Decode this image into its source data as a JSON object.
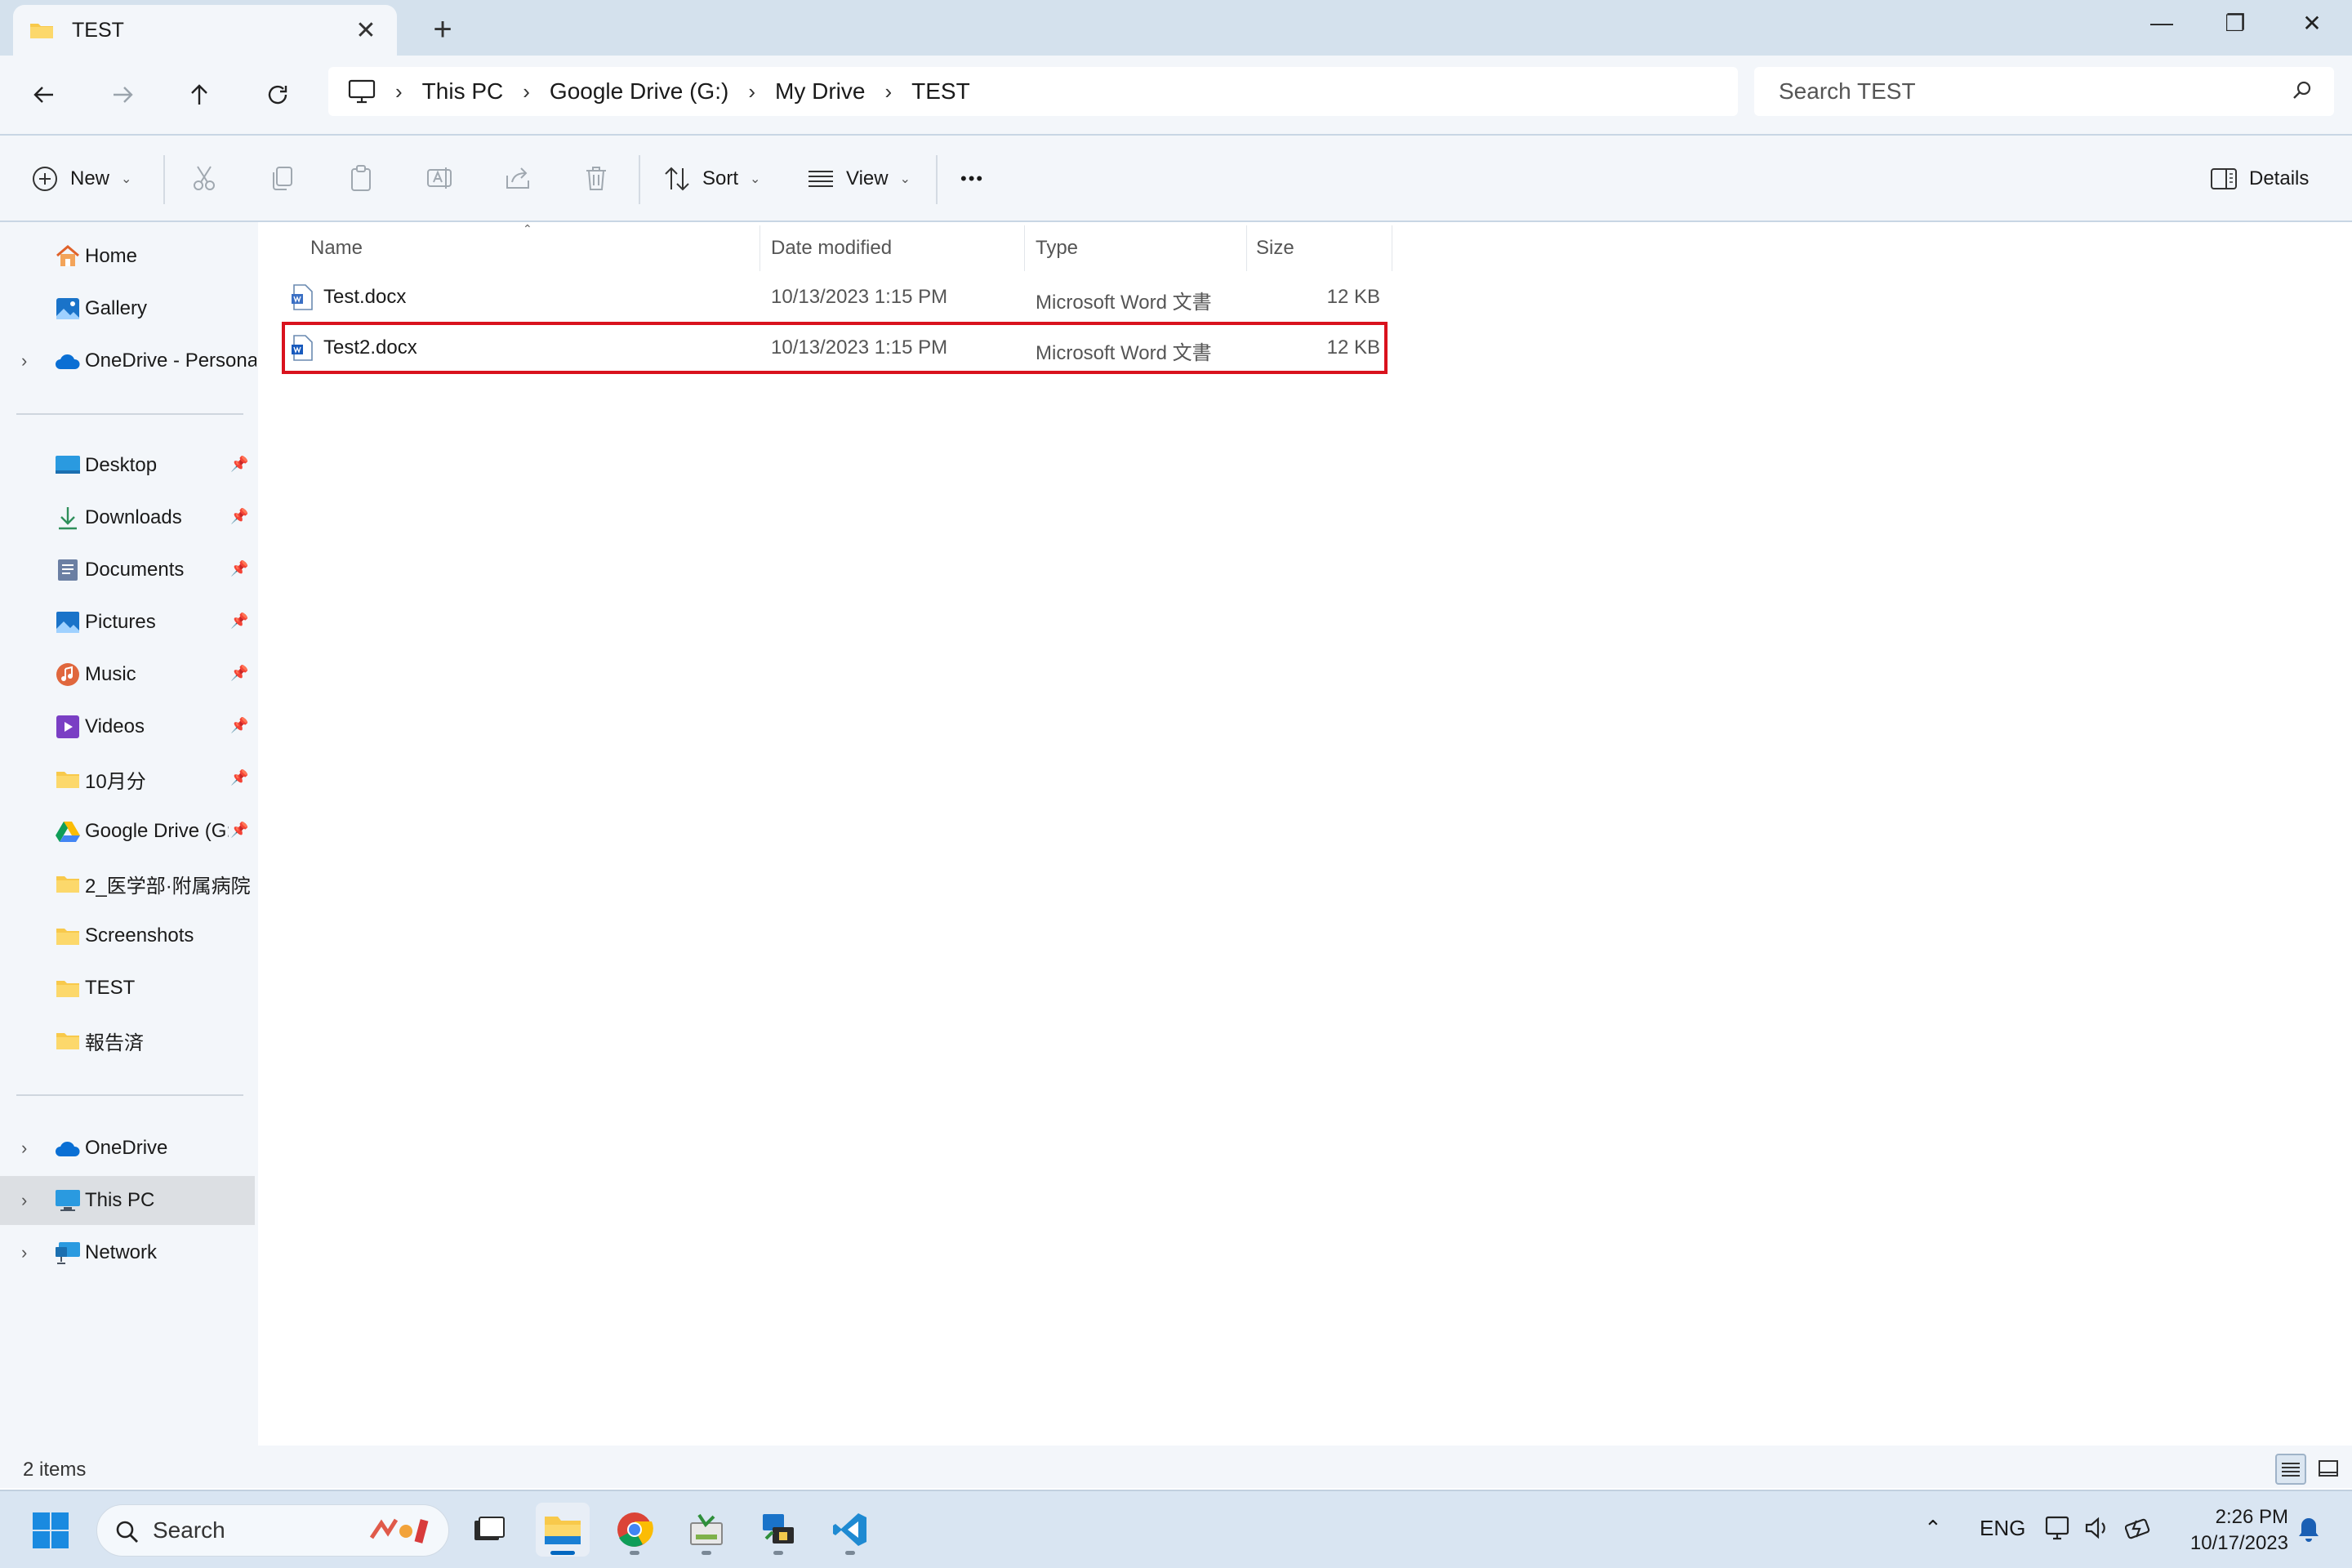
{
  "window": {
    "tab_title": "TEST",
    "controls": {
      "minimize": "—",
      "maximize": "❐",
      "close": "✕"
    }
  },
  "toolbar": {
    "breadcrumb": [
      "This PC",
      "Google Drive (G:)",
      "My Drive",
      "TEST"
    ],
    "search_placeholder": "Search TEST"
  },
  "commands": {
    "new_label": "New",
    "sort_label": "Sort",
    "view_label": "View",
    "more_label": "•••",
    "details_label": "Details"
  },
  "sidebar": {
    "quick": [
      {
        "label": "Home",
        "icon": "home-icon"
      },
      {
        "label": "Gallery",
        "icon": "gallery-icon"
      },
      {
        "label": "OneDrive - Personal",
        "icon": "cloud-icon"
      }
    ],
    "pinned": [
      {
        "label": "Desktop"
      },
      {
        "label": "Downloads"
      },
      {
        "label": "Documents"
      },
      {
        "label": "Pictures"
      },
      {
        "label": "Music"
      },
      {
        "label": "Videos"
      },
      {
        "label": "10月分"
      },
      {
        "label": "Google Drive (G:)"
      },
      {
        "label": "2_医学部·附属病院"
      },
      {
        "label": "Screenshots"
      },
      {
        "label": "TEST"
      },
      {
        "label": "報告済"
      }
    ],
    "roots": [
      {
        "label": "OneDrive"
      },
      {
        "label": "This PC"
      },
      {
        "label": "Network"
      }
    ]
  },
  "columns": {
    "name": "Name",
    "date": "Date modified",
    "type": "Type",
    "size": "Size"
  },
  "files": [
    {
      "name": "Test.docx",
      "date": "10/13/2023 1:15 PM",
      "type": "Microsoft Word 文書",
      "size": "12 KB"
    },
    {
      "name": "Test2.docx",
      "date": "10/13/2023 1:15 PM",
      "type": "Microsoft Word 文書",
      "size": "12 KB"
    }
  ],
  "status": {
    "items": "2 items"
  },
  "taskbar": {
    "search_label": "Search",
    "tray_lang": "ENG",
    "time": "2:26 PM",
    "date": "10/17/2023"
  },
  "colors": {
    "accent": "#0067c0",
    "highlight": "#d9121d",
    "folder": "#f8c94b"
  }
}
